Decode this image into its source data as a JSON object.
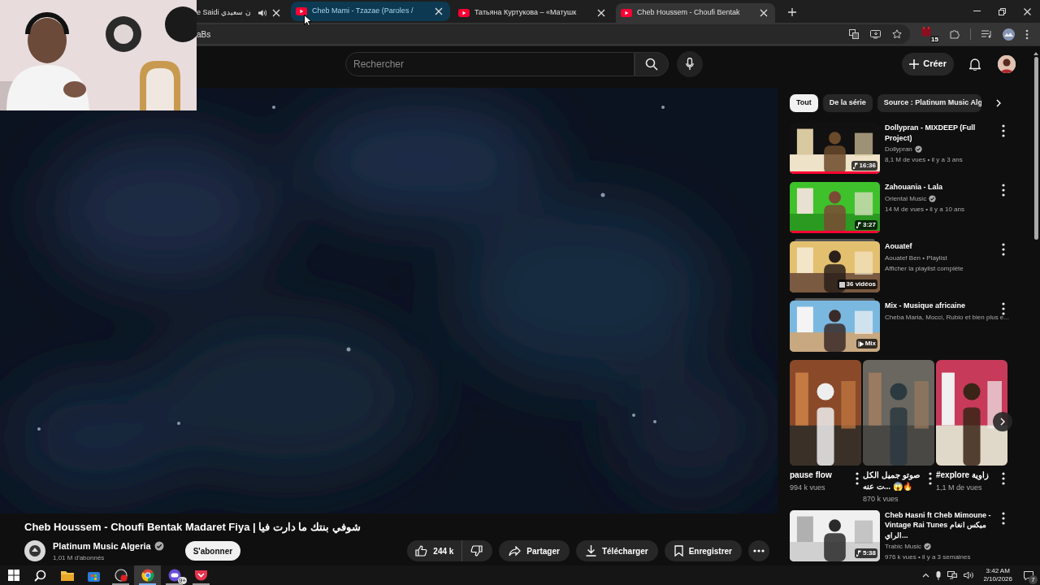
{
  "browser": {
    "tabs": [
      {
        "title": "e Saidi ن سعيدي",
        "selected": false,
        "hovered": false,
        "audio": true
      },
      {
        "title": "Cheb Mami - Tzazae (Paroles / ",
        "selected": false,
        "hovered": true,
        "audio": false
      },
      {
        "title": "Татьяна Куртукова – «Матушк",
        "selected": false,
        "hovered": false,
        "audio": false
      },
      {
        "title": "Cheb Houssem - Choufi Bentak",
        "selected": true,
        "hovered": false,
        "audio": false
      }
    ],
    "address_text": "aBs",
    "extension_badge": "15"
  },
  "masthead": {
    "search": {
      "placeholder": "Rechercher"
    },
    "create_button": "Créer"
  },
  "player": {
    "title": "Cheb Houssem - Choufi Bentak Madaret Fiya | شوفي بنتك ما دارت فيا",
    "channel": {
      "name": "Platinum Music Algeria",
      "verified": true,
      "subscribers": "1,01 M d'abonnés"
    },
    "subscribe_button": "S'abonner",
    "actions": [
      {
        "kind": "like",
        "label": "244 k"
      },
      {
        "kind": "dislike"
      },
      {
        "kind": "share",
        "label": "Partager"
      },
      {
        "kind": "download",
        "label": "Télécharger"
      },
      {
        "kind": "save",
        "label": "Enregistrer"
      },
      {
        "kind": "more"
      }
    ]
  },
  "sidebar": {
    "chips": [
      {
        "label": "Tout",
        "selected": true
      },
      {
        "label": "De la série",
        "selected": false
      },
      {
        "label": "Source : Platinum Music Alg",
        "selected": false
      }
    ],
    "items": [
      {
        "kind": "video",
        "title": "Dollypran - MIXDEEP (Full Project)",
        "channel": "Dollypran",
        "verified": true,
        "meta": "8,1 M de vues • il y a 3 ans",
        "badge": "16:36",
        "level": 1
      },
      {
        "kind": "video",
        "title": "Zahouania - Lala",
        "channel": "Oriental Music",
        "verified": true,
        "meta": "14 M de vues • il y a 10 ans",
        "badge": "3:27",
        "level": 1
      },
      {
        "kind": "playlist",
        "title": "Aouatef",
        "channel": "Aouatef Ben • Playlist",
        "verified": false,
        "meta": "Afficher la playlist complète",
        "badge": "36 vidéos"
      },
      {
        "kind": "mix",
        "title": "Mix - Musique africaine",
        "channel": "Cheba Maria, Mocci, Rubio et bien plus e...",
        "verified": false,
        "badge": "Mix"
      }
    ],
    "shorts": [
      {
        "title": "pause flow",
        "views": "994 k vues"
      },
      {
        "title": "صوتو جميل الكل ...ت عنه 😱🔥",
        "views": "870 k vues"
      },
      {
        "title": "#explore زاوية",
        "views": "1,1 M de vues"
      }
    ],
    "items_after": [
      {
        "kind": "video",
        "title": "Cheb Hasni ft Cheb Mimoune - Vintage Rai Tunes ميكس انغام الراي...",
        "channel": "Trabic Music",
        "verified": true,
        "meta": "976 k vues • il y a 3 semaines",
        "badge": "5:38"
      }
    ]
  },
  "taskbar": {
    "apps": [
      {
        "kind": "start",
        "running": false,
        "active": false
      },
      {
        "kind": "search",
        "running": false,
        "active": false
      },
      {
        "kind": "files",
        "running": false,
        "active": false
      },
      {
        "kind": "store",
        "running": false,
        "active": false
      },
      {
        "kind": "recorder",
        "running": true,
        "active": false
      },
      {
        "kind": "browser",
        "running": true,
        "active": true
      },
      {
        "kind": "chat",
        "running": true,
        "active": false,
        "badge": "9+"
      },
      {
        "kind": "pocket",
        "running": true,
        "active": false
      }
    ],
    "time": "3:42 AM",
    "date": "2/10/2026",
    "notifications": "7"
  }
}
